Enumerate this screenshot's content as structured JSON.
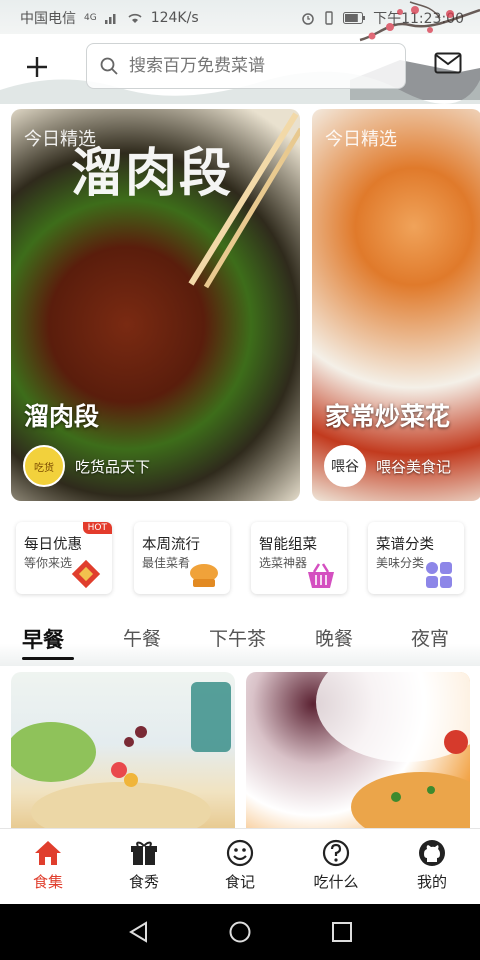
{
  "status_bar": {
    "carrier": "中国电信",
    "network": "4G",
    "speed": "124K/s",
    "time": "下午11:23:00",
    "battery_level": 0.8
  },
  "search": {
    "placeholder": "搜索百万免费菜谱"
  },
  "hero_cards": [
    {
      "tag": "今日精选",
      "title": "溜肉段",
      "calligraphy": "溜肉段",
      "author": "吃货品天下",
      "avatar_text": "吃货"
    },
    {
      "tag": "今日精选",
      "title": "家常炒菜花",
      "author": "喂谷美食记",
      "avatar_text": "喂谷"
    }
  ],
  "features": [
    {
      "title": "每日优惠",
      "subtitle": "等你来选",
      "badge": "HOT",
      "icon": "fu-gift-icon"
    },
    {
      "title": "本周流行",
      "subtitle": "最佳菜肴",
      "icon": "chef-hat-icon"
    },
    {
      "title": "智能组菜",
      "subtitle": "选菜神器",
      "icon": "basket-icon"
    },
    {
      "title": "菜谱分类",
      "subtitle": "美味分类",
      "icon": "grid-icon"
    }
  ],
  "meal_tabs": [
    "早餐",
    "午餐",
    "下午茶",
    "晚餐",
    "夜宵"
  ],
  "active_meal_tab": "早餐",
  "bottom_nav": [
    {
      "label": "食集",
      "icon": "home-icon",
      "active": true
    },
    {
      "label": "食秀",
      "icon": "gift-icon",
      "active": false
    },
    {
      "label": "食记",
      "icon": "smile-icon",
      "active": false
    },
    {
      "label": "吃什么",
      "icon": "question-icon",
      "active": false
    },
    {
      "label": "我的",
      "icon": "github-icon",
      "active": false
    }
  ],
  "colors": {
    "accent": "#e03e2d",
    "hot_badge": "#e33b2c",
    "basket": "#d44fc0",
    "grid": "#8d86e8",
    "hat": "#f0a23a"
  }
}
